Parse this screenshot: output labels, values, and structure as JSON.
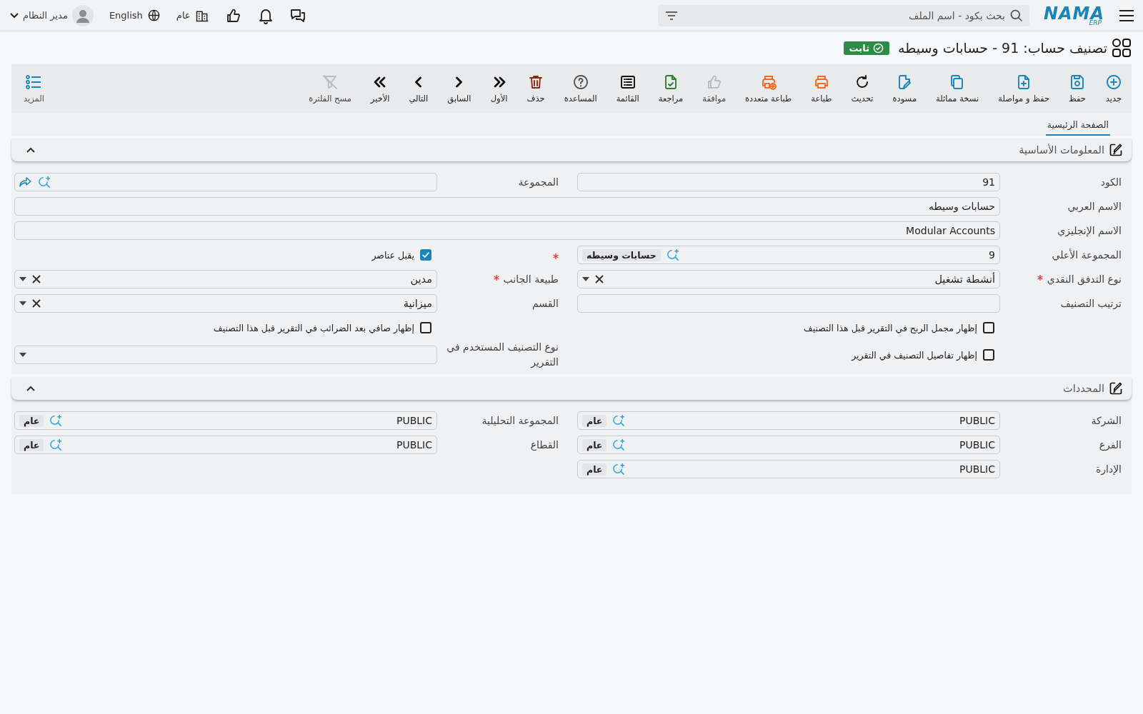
{
  "header": {
    "logo": "NAMA",
    "logo_sub": "ERP",
    "search": {
      "placeholder": "بحث بكود - اسم الملف"
    },
    "organization": "عام",
    "language": "English",
    "user": "مدير النظام"
  },
  "title": "تصنيف حساب: 91 - حسابات وسيطه",
  "status": "ثابت",
  "toolbar": [
    {
      "kind": "new",
      "label": "جديد",
      "color": "#1a86b8",
      "disabled": false
    },
    {
      "kind": "save",
      "label": "حفظ",
      "color": "#1a86b8",
      "disabled": false
    },
    {
      "kind": "save_continue",
      "label": "حفظ و مواصلة",
      "color": "#1a86b8",
      "disabled": false
    },
    {
      "kind": "duplicate",
      "label": "نسخة مماثلة",
      "color": "#1a86b8",
      "disabled": false
    },
    {
      "kind": "draft",
      "label": "مسودة",
      "color": "#1a86b8",
      "disabled": false
    },
    {
      "kind": "refresh",
      "label": "تحديث",
      "color": "#111111",
      "disabled": false
    },
    {
      "kind": "print",
      "label": "طباعة",
      "color": "#f26a21",
      "disabled": false
    },
    {
      "kind": "multi_print",
      "label": "طباعة متعددة",
      "color": "#f26a21",
      "disabled": false
    },
    {
      "kind": "approve",
      "label": "موافقة",
      "disabled": true
    },
    {
      "kind": "review",
      "label": "مراجعة",
      "color": "#2e7d32",
      "disabled": false
    },
    {
      "kind": "list",
      "label": "القائمة",
      "color": "#111111",
      "disabled": false
    },
    {
      "kind": "help",
      "label": "المساعدة",
      "color": "#555555",
      "disabled": false
    },
    {
      "kind": "delete",
      "label": "حذف",
      "color": "#8b2a12",
      "disabled": false
    },
    {
      "kind": "first",
      "label": "الأول",
      "color": "#111111",
      "disabled": false
    },
    {
      "kind": "previous",
      "label": "السابق",
      "color": "#111111",
      "disabled": false
    },
    {
      "kind": "next",
      "label": "التالي",
      "color": "#111111",
      "disabled": false
    },
    {
      "kind": "last",
      "label": "الأخير",
      "color": "#111111",
      "disabled": false
    },
    {
      "kind": "clear_filter",
      "label": "مسح الفلترة",
      "disabled": true
    }
  ],
  "more": {
    "label": "المزيد"
  },
  "tabs": [
    {
      "label": "الصفحة الرئيسية",
      "selected": true
    }
  ],
  "sections": [
    {
      "title": "المعلومات الأساسية",
      "expanded": true,
      "rows": [
        {
          "right": {
            "kind": "text",
            "label": "الكود",
            "value": "91"
          },
          "left": {
            "kind": "lookup",
            "label": "المجموعة",
            "open_link": true
          }
        },
        {
          "full": {
            "kind": "text",
            "label": "الاسم العربي",
            "value": "حسابات وسيطه"
          }
        },
        {
          "full": {
            "kind": "text",
            "label": "الاسم الإنجليزي",
            "value": "Modular Accounts"
          }
        },
        {
          "right": {
            "kind": "lookup",
            "label": "المجموعة الأعلي",
            "value": "9",
            "tag": "حسابات وسيطه",
            "open_link": false
          },
          "left": {
            "kind": "checkbox",
            "text": "يقبل عناصر",
            "checked": true,
            "required": true
          }
        },
        {
          "right": {
            "kind": "select",
            "label": "نوع التدفق النقدي",
            "value": "أنشطة تشغيل",
            "required": true,
            "clearable": true
          },
          "left": {
            "kind": "select",
            "label": "طبيعة الجانب",
            "value": "مدين",
            "required": true,
            "clearable": true
          }
        },
        {
          "right": {
            "kind": "text",
            "label": "ترتيب التصنيف"
          },
          "left": {
            "kind": "select",
            "label": "القسم",
            "value": "ميزانية",
            "required": false,
            "clearable": true
          }
        },
        {
          "right": {
            "kind": "checkbox",
            "text": "إظهار مجمل الربح في التقرير قبل هذا التصنيف",
            "checked": false,
            "required": false
          },
          "left": {
            "kind": "checkbox",
            "text": "إظهار صافي بعد الضرائب في التقرير قبل هذا التصنيف",
            "checked": false,
            "required": false
          }
        },
        {
          "right": {
            "kind": "checkbox",
            "text": "إظهار تفاصيل التصنيف في التقرير",
            "checked": false,
            "required": false
          },
          "left": {
            "kind": "select",
            "label": "نوع التصنيف المستخدم في التقرير",
            "required": false,
            "clearable": false
          }
        }
      ]
    },
    {
      "title": "المحددات",
      "expanded": true,
      "rows": [
        {
          "right": {
            "kind": "lookup",
            "label": "الشركة",
            "value": "PUBLIC",
            "tag": "عام",
            "open_link": false
          },
          "left": {
            "kind": "lookup",
            "label": "المجموعة التحليلية",
            "value": "PUBLIC",
            "tag": "عام",
            "open_link": false
          }
        },
        {
          "right": {
            "kind": "lookup",
            "label": "الفرع",
            "value": "PUBLIC",
            "tag": "عام",
            "open_link": false
          },
          "left": {
            "kind": "lookup",
            "label": "القطاع",
            "value": "PUBLIC",
            "tag": "عام",
            "open_link": false
          }
        },
        {
          "right": {
            "kind": "lookup",
            "label": "الإدارة",
            "value": "PUBLIC",
            "tag": "عام",
            "open_link": false
          }
        }
      ]
    }
  ]
}
